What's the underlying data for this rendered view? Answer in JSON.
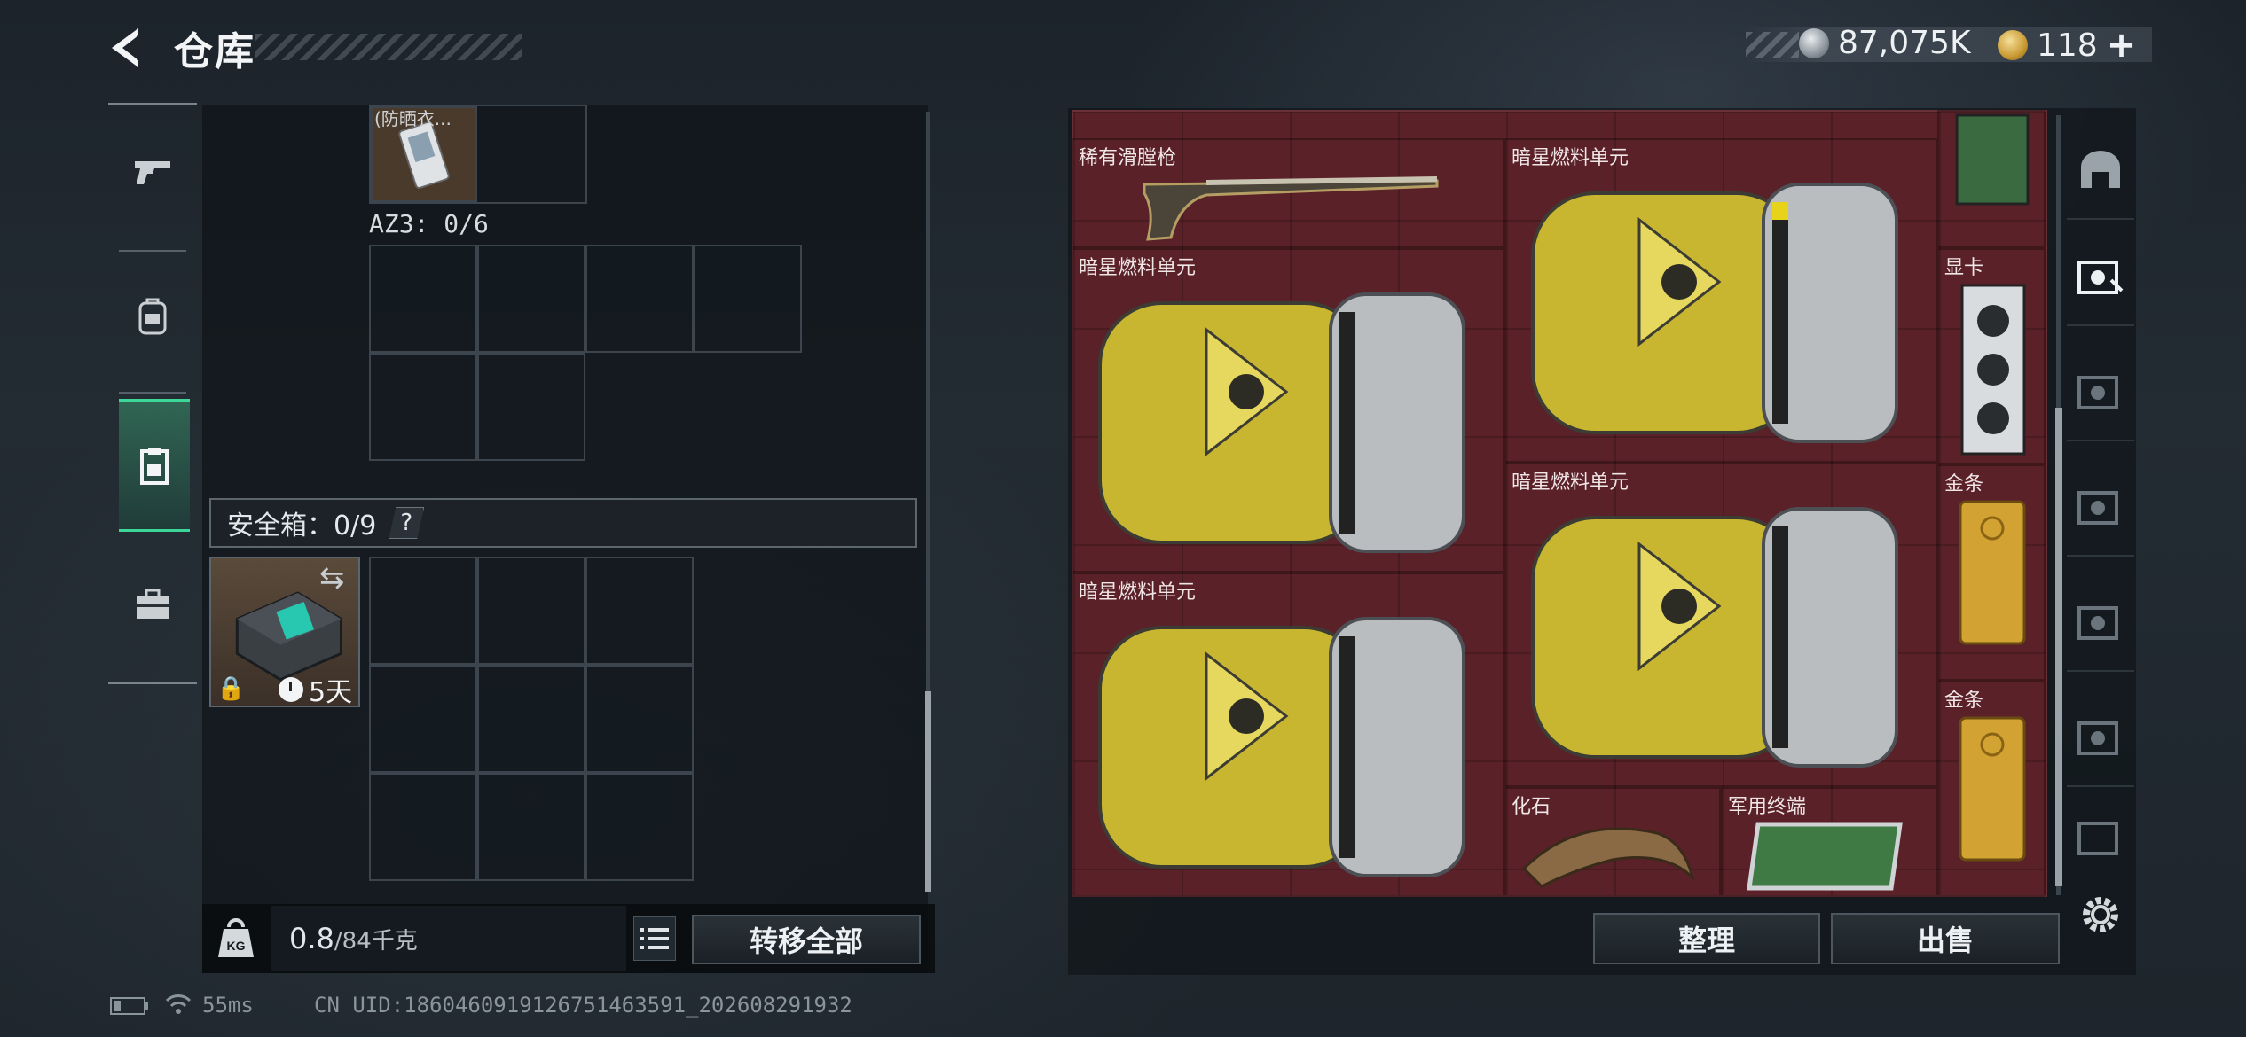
{
  "header": {
    "title": "仓库",
    "currencies": [
      {
        "icon": "silver-coin-icon",
        "value": "87,075K"
      },
      {
        "icon": "gold-coin-icon",
        "value": "118"
      }
    ],
    "plus": "+"
  },
  "left_nav": {
    "items": [
      {
        "name": "weapon",
        "icon": "pistol-icon"
      },
      {
        "name": "gear",
        "icon": "backpack-icon"
      },
      {
        "name": "container",
        "icon": "clipboard-icon",
        "active": true
      },
      {
        "name": "case",
        "icon": "briefcase-icon"
      }
    ]
  },
  "inventory": {
    "top_item_label": "(防晒衣...",
    "az3_label": "AZ3: 0/6",
    "safebox_label": "安全箱：0/9",
    "help": "?",
    "safebox_timer": "5天",
    "weight_value": "0.8",
    "weight_max": "/84千克",
    "transfer_all": "转移全部"
  },
  "stash": {
    "items": [
      {
        "label": "稀有滑膛枪"
      },
      {
        "label": "暗星燃料单元"
      },
      {
        "label": "暗星燃料单元"
      },
      {
        "label": "显卡"
      },
      {
        "label": "暗星燃料单元"
      },
      {
        "label": "金条"
      },
      {
        "label": "暗星燃料单元"
      },
      {
        "label": "金条"
      },
      {
        "label": "化石"
      },
      {
        "label": "军用终端"
      }
    ],
    "sort_button": "整理",
    "sell_button": "出售"
  },
  "status_bar": {
    "ping": "55ms",
    "uid": "CN UID:1860460919126751463591_202608291932"
  },
  "colors": {
    "accent_green": "#3ed79a",
    "stash_bg": "#5a2128",
    "fuel_yellow": "#c8b631"
  }
}
